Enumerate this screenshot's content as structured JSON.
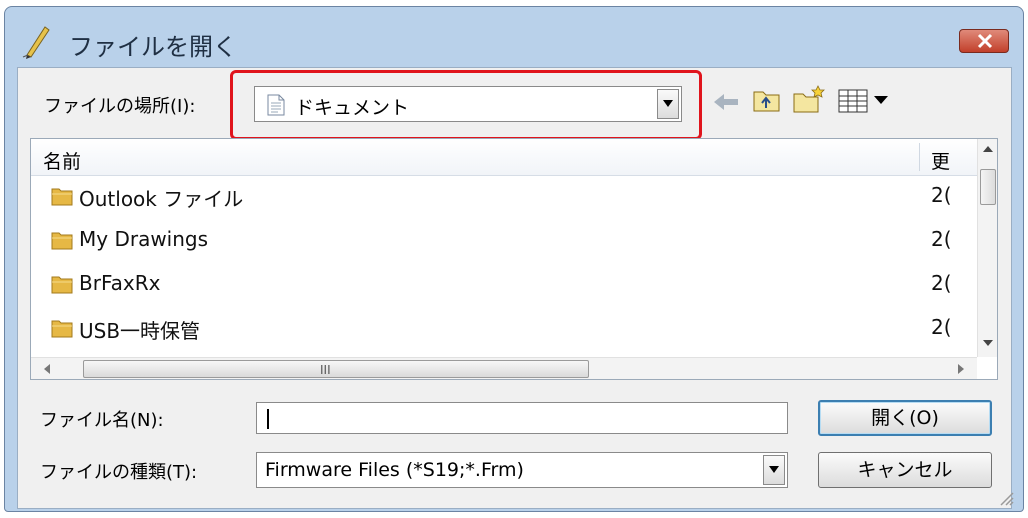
{
  "window": {
    "title": "ファイルを開く",
    "close_icon": "close-x-icon",
    "title_icon": "pencil-icon"
  },
  "location": {
    "label": "ファイルの場所(I):",
    "value": "ドキュメント",
    "value_icon": "document-icon"
  },
  "toolbar": {
    "back_icon": "back-arrow-icon",
    "up_icon": "up-folder-icon",
    "new_folder_icon": "new-folder-icon",
    "view_icon": "view-menu-icon"
  },
  "list": {
    "columns": [
      "名前",
      "更"
    ],
    "items": [
      {
        "name": "Outlook ファイル",
        "date": "2("
      },
      {
        "name": "My Drawings",
        "date": "2("
      },
      {
        "name": "BrFaxRx",
        "date": "2("
      },
      {
        "name": "USB一時保管",
        "date": "2("
      }
    ],
    "hscroll_grip": "III"
  },
  "filename": {
    "label": "ファイル名(N):",
    "value": ""
  },
  "filetype": {
    "label": "ファイルの種類(T):",
    "value": "Firmware Files (*S19;*.Frm)"
  },
  "buttons": {
    "open": "開く(O)",
    "cancel": "キャンセル"
  },
  "colors": {
    "highlight": "#e0141c",
    "titlebar": "#b9d1ea",
    "close": "#c2402b"
  }
}
